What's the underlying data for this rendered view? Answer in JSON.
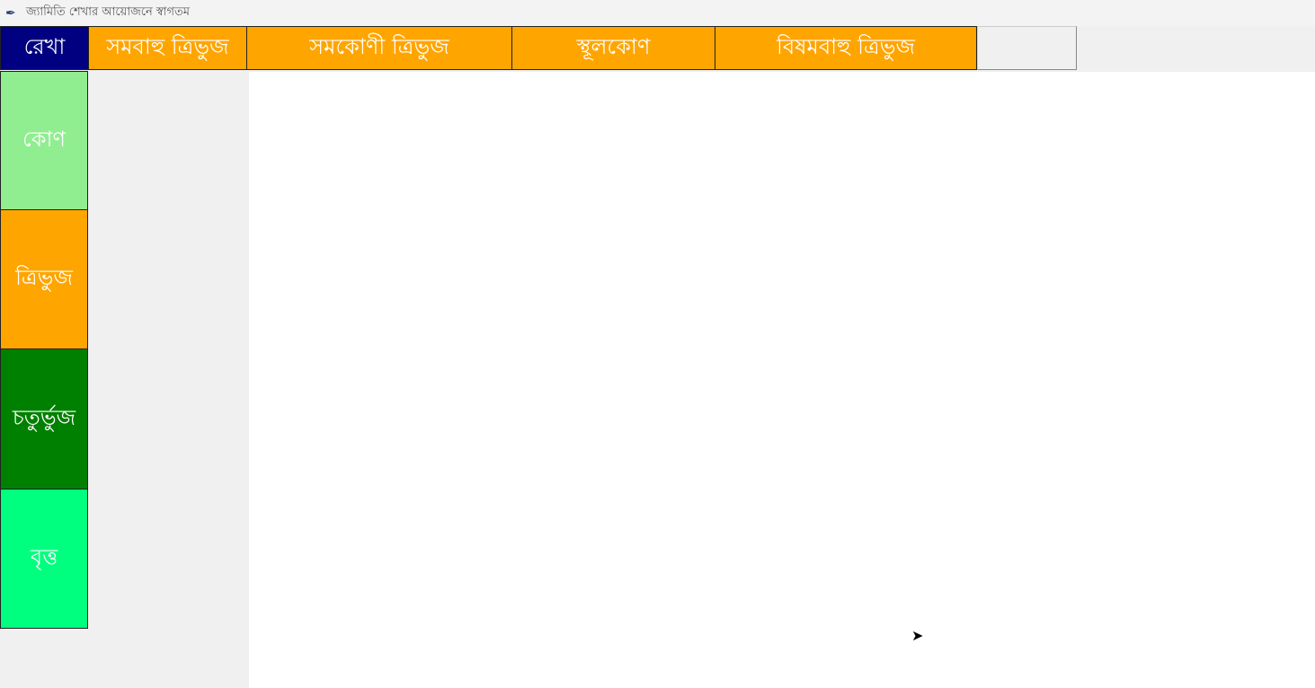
{
  "window": {
    "title": "জ্যামিতি শেখার আয়োজনে স্বাগতম"
  },
  "top_buttons": [
    {
      "label": "রেখা",
      "color": "#000080"
    },
    {
      "label": "সমবাহু ত্রিভুজ",
      "color": "#ffa500"
    },
    {
      "label": "সমকোণী ত্রিভুজ",
      "color": "#ffa500"
    },
    {
      "label": "স্থূলকোণ",
      "color": "#ffa500"
    },
    {
      "label": "বিষমবাহু ত্রিভুজ",
      "color": "#ffa500"
    },
    {
      "label": "",
      "color": "#f0f0f0"
    }
  ],
  "side_buttons": [
    {
      "label": "কোণ",
      "color": "#90ee90"
    },
    {
      "label": "ত্রিভুজ",
      "color": "#ffa500"
    },
    {
      "label": "চতুর্ভুজ",
      "color": "#008000"
    },
    {
      "label": "বৃত্ত",
      "color": "#00ff7f"
    }
  ]
}
